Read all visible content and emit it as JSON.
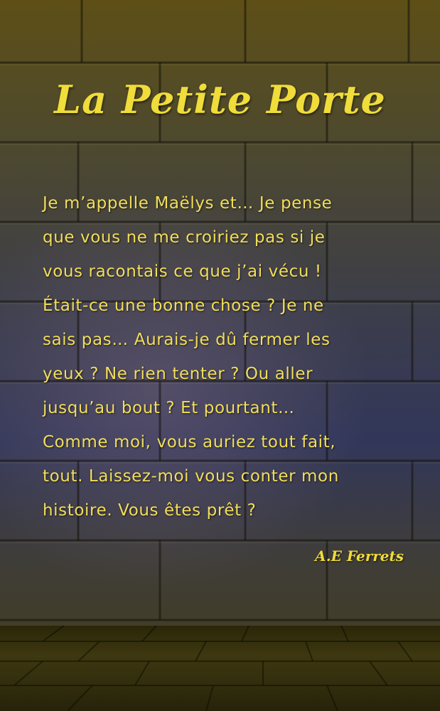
{
  "cover": {
    "title": "La Petite Porte",
    "blurb_lines": [
      "Je m’appelle Maëlys et… Je pense",
      "que vous ne me croiriez pas si je",
      "vous racontais ce que j’ai vécu !",
      "Était-ce une bonne chose ? Je ne",
      "sais pas… Aurais-je dû fermer les",
      "yeux ? Ne rien tenter ? Ou aller",
      "jusqu’au bout ? Et pourtant…",
      "Comme moi, vous auriez tout fait,",
      "tout. Laissez-moi vous conter mon",
      "histoire. Vous êtes prêt ?"
    ],
    "author": "A.E Ferrets"
  },
  "colors": {
    "text": "#f2de5a",
    "title": "#f0dc3a"
  }
}
